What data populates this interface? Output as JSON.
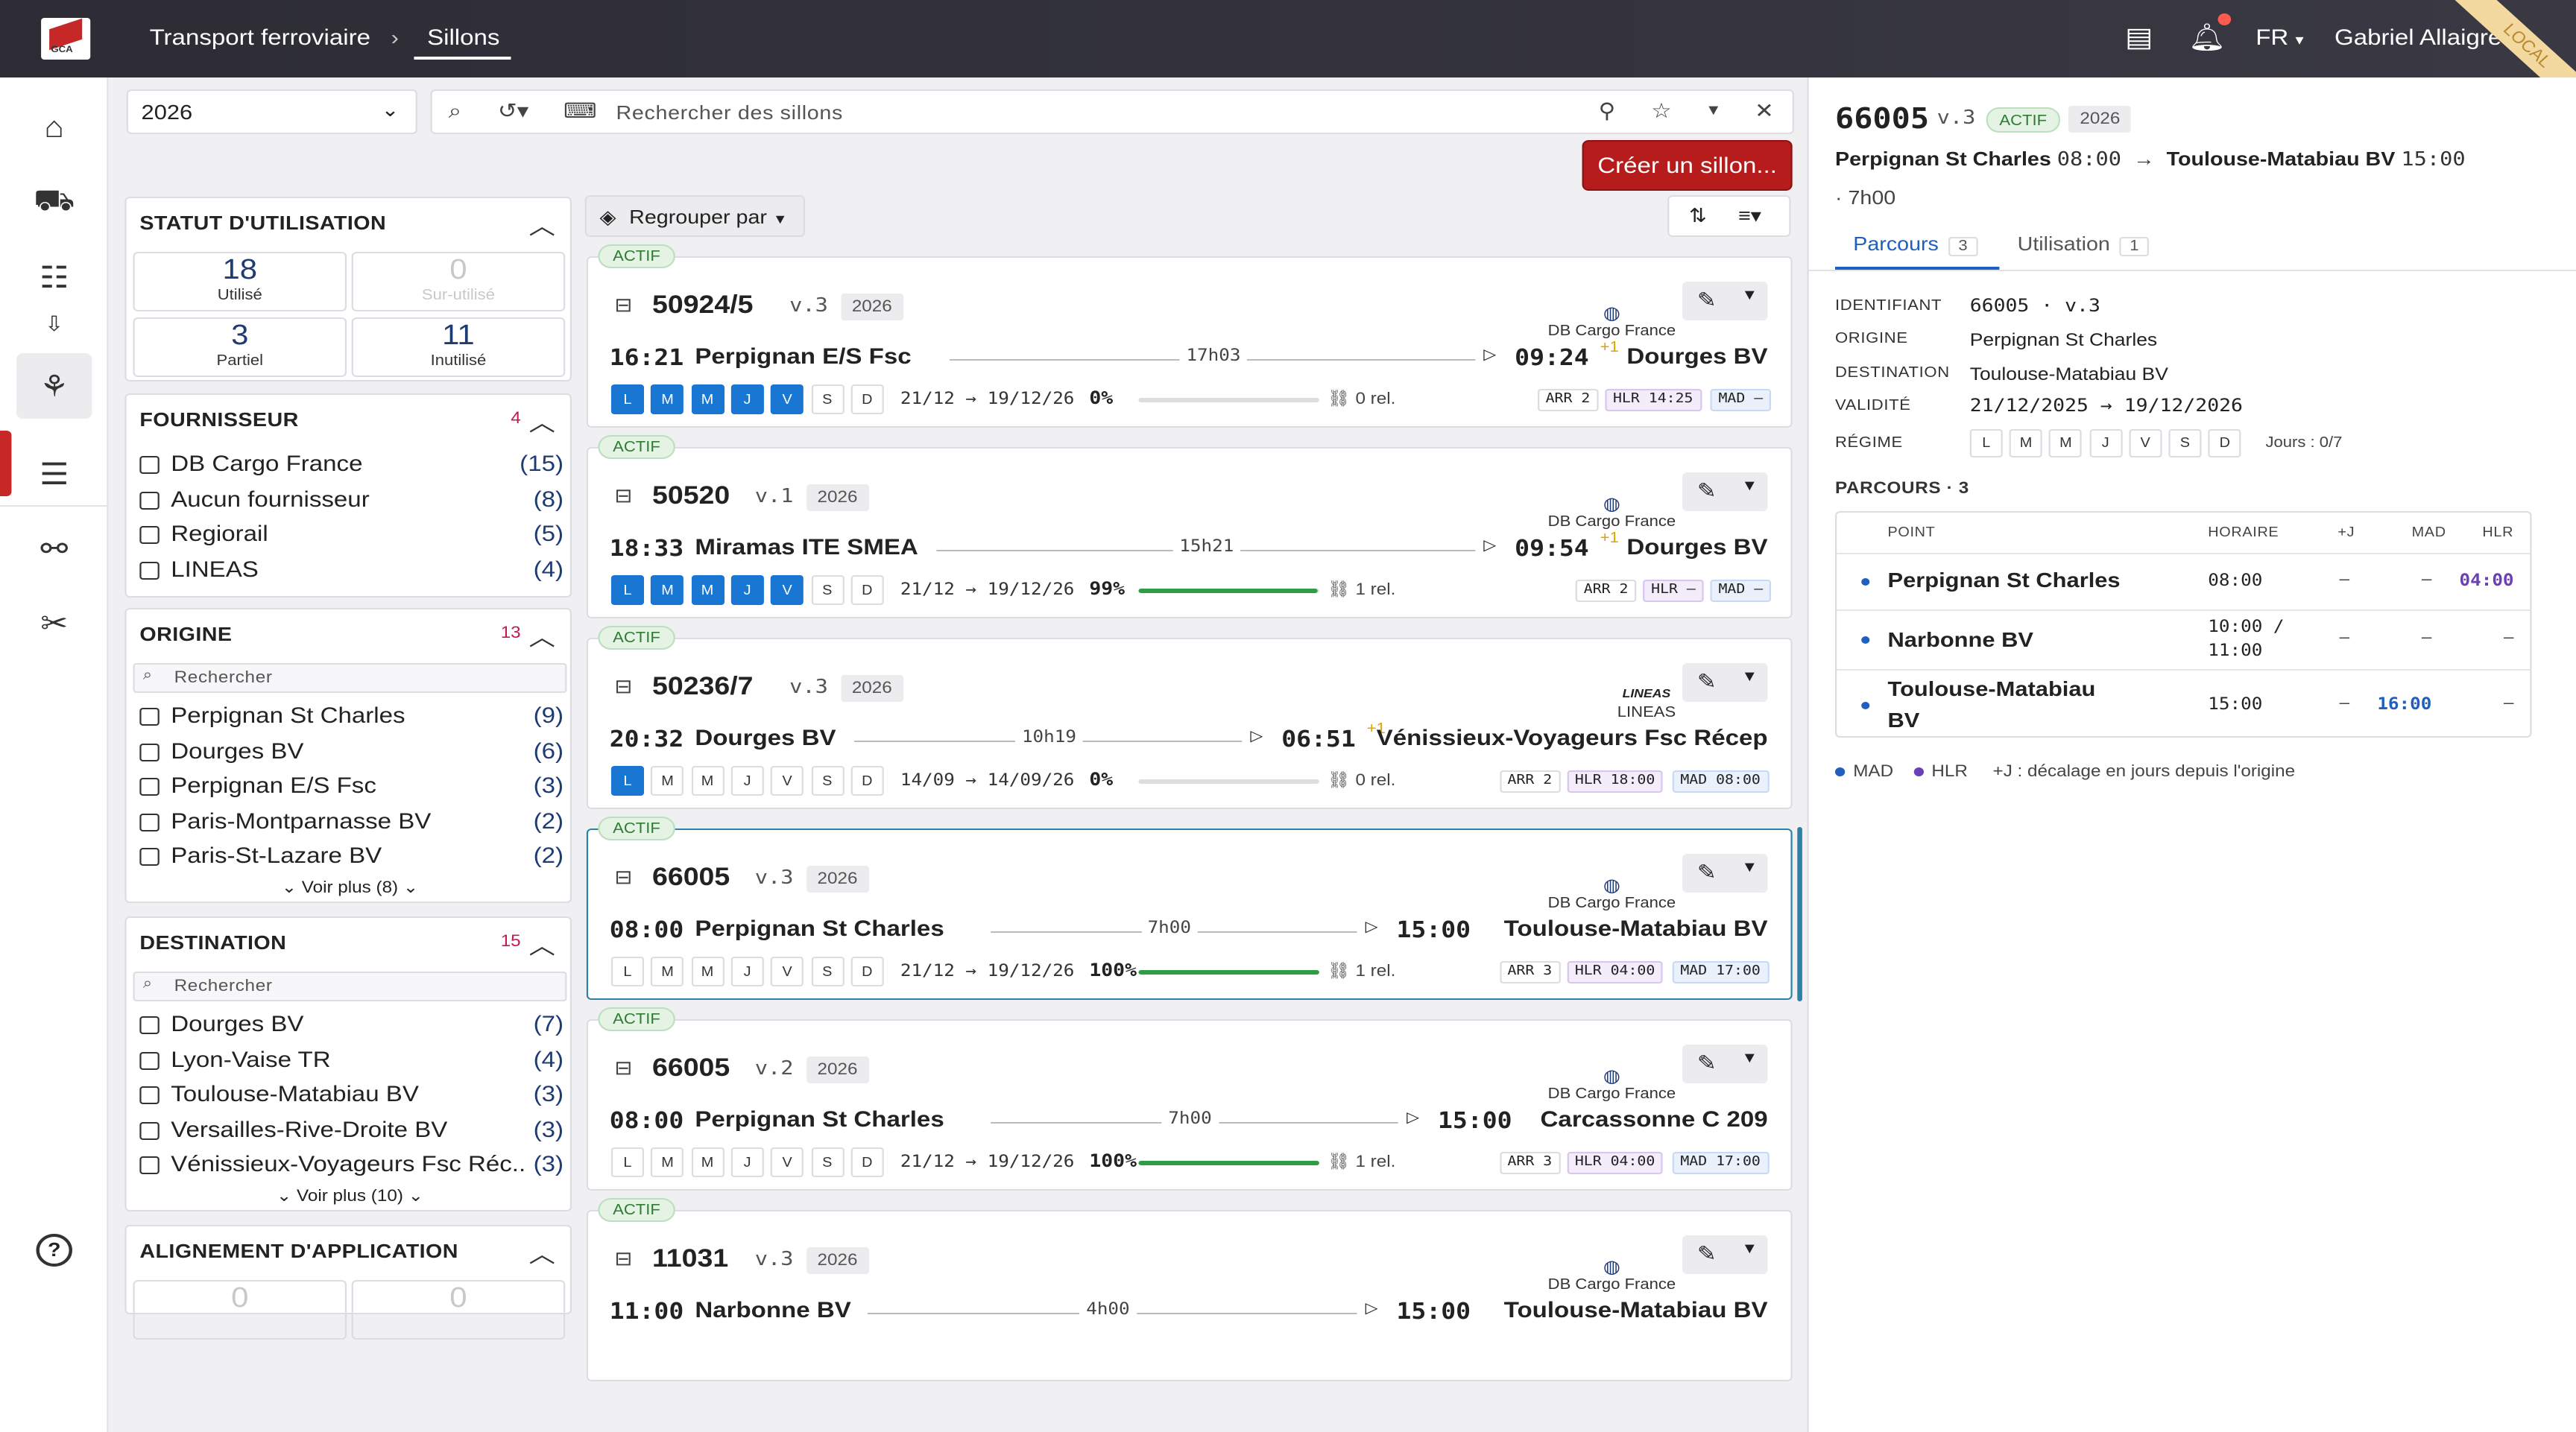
{
  "header": {
    "breadcrumb_1": "Transport ferroviaire",
    "breadcrumb_2": "Sillons",
    "lang": "FR",
    "user": "Gabriel Allaigre",
    "ribbon": "LOCAL",
    "logo_text": "GCA"
  },
  "toolbar": {
    "year": "2026",
    "search_placeholder": "Rechercher des sillons",
    "create_label": "Créer un sillon...",
    "groupby_label": "Regrouper par"
  },
  "filters": {
    "statut": {
      "title": "STATUT D'UTILISATION",
      "items": [
        {
          "n": "18",
          "label": "Utilisé"
        },
        {
          "n": "0",
          "label": "Sur-utilisé"
        },
        {
          "n": "3",
          "label": "Partiel"
        },
        {
          "n": "11",
          "label": "Inutilisé"
        }
      ]
    },
    "fournisseur": {
      "title": "FOURNISSEUR",
      "count": "4",
      "items": [
        {
          "label": "DB Cargo France",
          "count": "(15)"
        },
        {
          "label": "Aucun fournisseur",
          "count": "(8)"
        },
        {
          "label": "Regiorail",
          "count": "(5)"
        },
        {
          "label": "LINEAS",
          "count": "(4)"
        }
      ]
    },
    "origine": {
      "title": "ORIGINE",
      "count": "13",
      "search": "Rechercher",
      "more": "Voir plus (8)",
      "items": [
        {
          "label": "Perpignan St Charles",
          "count": "(9)"
        },
        {
          "label": "Dourges BV",
          "count": "(6)"
        },
        {
          "label": "Perpignan E/S Fsc",
          "count": "(3)"
        },
        {
          "label": "Paris-Montparnasse BV",
          "count": "(2)"
        },
        {
          "label": "Paris-St-Lazare BV",
          "count": "(2)"
        }
      ]
    },
    "destination": {
      "title": "DESTINATION",
      "count": "15",
      "search": "Rechercher",
      "more": "Voir plus (10)",
      "items": [
        {
          "label": "Dourges BV",
          "count": "(7)"
        },
        {
          "label": "Lyon-Vaise TR",
          "count": "(4)"
        },
        {
          "label": "Toulouse-Matabiau BV",
          "count": "(3)"
        },
        {
          "label": "Versailles-Rive-Droite BV",
          "count": "(3)"
        },
        {
          "label": "Vénissieux-Voyageurs Fsc Réc...",
          "count": "(3)"
        }
      ]
    },
    "alignement": {
      "title": "ALIGNEMENT D'APPLICATION",
      "items": [
        {
          "n": "0"
        },
        {
          "n": "0"
        }
      ]
    }
  },
  "cards": [
    {
      "status": "ACTIF",
      "num": "50924/5",
      "ver": "v.3",
      "year": "2026",
      "supplier": "DB Cargo France",
      "dep": "16:21",
      "orig": "Perpignan E/S Fsc",
      "dur": "17h03",
      "arr": "09:24",
      "plus": "+1",
      "dest": "Dourges BV",
      "days_label": [
        "L",
        "M",
        "M",
        "J",
        "V",
        "S",
        "D"
      ],
      "days_on": [
        1,
        1,
        1,
        1,
        1,
        0,
        0
      ],
      "range": "21/12 → 19/12/26",
      "pct": "0%",
      "fill": 0,
      "rel": "0 rel.",
      "arr_tag": "ARR 2",
      "hlr": "HLR 14:25",
      "mad": "MAD –"
    },
    {
      "status": "ACTIF",
      "num": "50520",
      "ver": "v.1",
      "year": "2026",
      "supplier": "DB Cargo France",
      "dep": "18:33",
      "orig": "Miramas ITE SMEA",
      "dur": "15h21",
      "arr": "09:54",
      "plus": "+1",
      "dest": "Dourges BV",
      "days_label": [
        "L",
        "M",
        "M",
        "J",
        "V",
        "S",
        "D"
      ],
      "days_on": [
        1,
        1,
        1,
        1,
        1,
        0,
        0
      ],
      "range": "21/12 → 19/12/26",
      "pct": "99%",
      "fill": 0.99,
      "rel": "1 rel.",
      "arr_tag": "ARR 2",
      "hlr": "HLR –",
      "mad": "MAD –"
    },
    {
      "status": "ACTIF",
      "num": "50236/7",
      "ver": "v.3",
      "year": "2026",
      "supplier": "LINEAS",
      "supplier_logo": "LINEAS",
      "dep": "20:32",
      "orig": "Dourges BV",
      "dur": "10h19",
      "arr": "06:51",
      "plus": "+1",
      "dest": "Vénissieux-Voyageurs Fsc Récep",
      "days_label": [
        "L",
        "M",
        "M",
        "J",
        "V",
        "S",
        "D"
      ],
      "days_on": [
        1,
        0,
        0,
        0,
        0,
        0,
        0
      ],
      "range": "14/09 → 14/09/26",
      "pct": "0%",
      "fill": 0,
      "rel": "0 rel.",
      "arr_tag": "ARR 2",
      "hlr": "HLR 18:00",
      "mad": "MAD 08:00"
    },
    {
      "status": "ACTIF",
      "num": "66005",
      "ver": "v.3",
      "year": "2026",
      "supplier": "DB Cargo France",
      "dep": "08:00",
      "orig": "Perpignan St Charles",
      "dur": "7h00",
      "arr": "15:00",
      "plus": "",
      "dest": "Toulouse-Matabiau BV",
      "days_label": [
        "L",
        "M",
        "M",
        "J",
        "V",
        "S",
        "D"
      ],
      "days_on": [
        0,
        0,
        0,
        0,
        0,
        0,
        0
      ],
      "range": "21/12 → 19/12/26",
      "pct": "100%",
      "fill": 1,
      "rel": "1 rel.",
      "arr_tag": "ARR 3",
      "hlr": "HLR 04:00",
      "mad": "MAD 17:00"
    },
    {
      "status": "ACTIF",
      "num": "66005",
      "ver": "v.2",
      "year": "2026",
      "supplier": "DB Cargo France",
      "dep": "08:00",
      "orig": "Perpignan St Charles",
      "dur": "7h00",
      "arr": "15:00",
      "plus": "",
      "dest": "Carcassonne C 209",
      "days_label": [
        "L",
        "M",
        "M",
        "J",
        "V",
        "S",
        "D"
      ],
      "days_on": [
        0,
        0,
        0,
        0,
        0,
        0,
        0
      ],
      "range": "21/12 → 19/12/26",
      "pct": "100%",
      "fill": 1,
      "rel": "1 rel.",
      "arr_tag": "ARR 3",
      "hlr": "HLR 04:00",
      "mad": "MAD 17:00"
    },
    {
      "status": "ACTIF",
      "num": "11031",
      "ver": "v.3",
      "year": "2026",
      "supplier": "DB Cargo France",
      "dep": "11:00",
      "orig": "Narbonne BV",
      "dur": "4h00",
      "arr": "15:00",
      "plus": "",
      "dest": "Toulouse-Matabiau BV",
      "days_label": [
        "L",
        "M",
        "M",
        "J",
        "V",
        "S",
        "D"
      ],
      "days_on": [
        0,
        0,
        0,
        0,
        0,
        0,
        0
      ],
      "range": "",
      "pct": "",
      "fill": 0,
      "rel": "",
      "arr_tag": "",
      "hlr": "",
      "mad": ""
    }
  ],
  "detail": {
    "num": "66005",
    "ver": "v.3",
    "status": "ACTIF",
    "year": "2026",
    "orig": "Perpignan St Charles",
    "dep": "08:00",
    "dest": "Toulouse-Matabiau BV",
    "arr": "15:00",
    "dur": "· 7h00",
    "tabs": [
      {
        "label": "Parcours",
        "count": "3"
      },
      {
        "label": "Utilisation",
        "count": "1"
      }
    ],
    "fields": {
      "id_k": "IDENTIFIANT",
      "id_v": "66005 · v.3",
      "orig_k": "ORIGINE",
      "orig_v": "Perpignan St Charles",
      "dest_k": "DESTINATION",
      "dest_v": "Toulouse-Matabiau BV",
      "valid_k": "VALIDITÉ",
      "valid_v": "21/12/2025 → 19/12/2026",
      "regime_k": "RÉGIME",
      "jours": "Jours : 0/7"
    },
    "regime_days": [
      "L",
      "M",
      "M",
      "J",
      "V",
      "S",
      "D"
    ],
    "parcours_title": "PARCOURS · 3",
    "table_headers": {
      "point": "POINT",
      "horaire": "HORAIRE",
      "j": "+J",
      "mad": "MAD",
      "hlr": "HLR"
    },
    "rows": [
      {
        "point": "Perpignan St Charles",
        "horaire": "08:00",
        "j": "–",
        "mad": "–",
        "hlr": "04:00"
      },
      {
        "point": "Narbonne BV",
        "horaire_1": "10:00 /",
        "horaire_2": "11:00",
        "j": "–",
        "mad": "–",
        "hlr": "–"
      },
      {
        "point_1": "Toulouse-Matabiau",
        "point_2": "BV",
        "horaire": "15:00",
        "j": "–",
        "mad": "16:00",
        "hlr": "–"
      }
    ],
    "legend": {
      "mad": "MAD",
      "hlr": "HLR",
      "note": "+J : décalage en jours depuis l'origine"
    }
  },
  "colors": {
    "accent": "#b71c1c",
    "day_on": "#1976d2",
    "progress": "#2e9d46",
    "mad": "#1f5fbf",
    "hlr": "#6b3fb8"
  }
}
